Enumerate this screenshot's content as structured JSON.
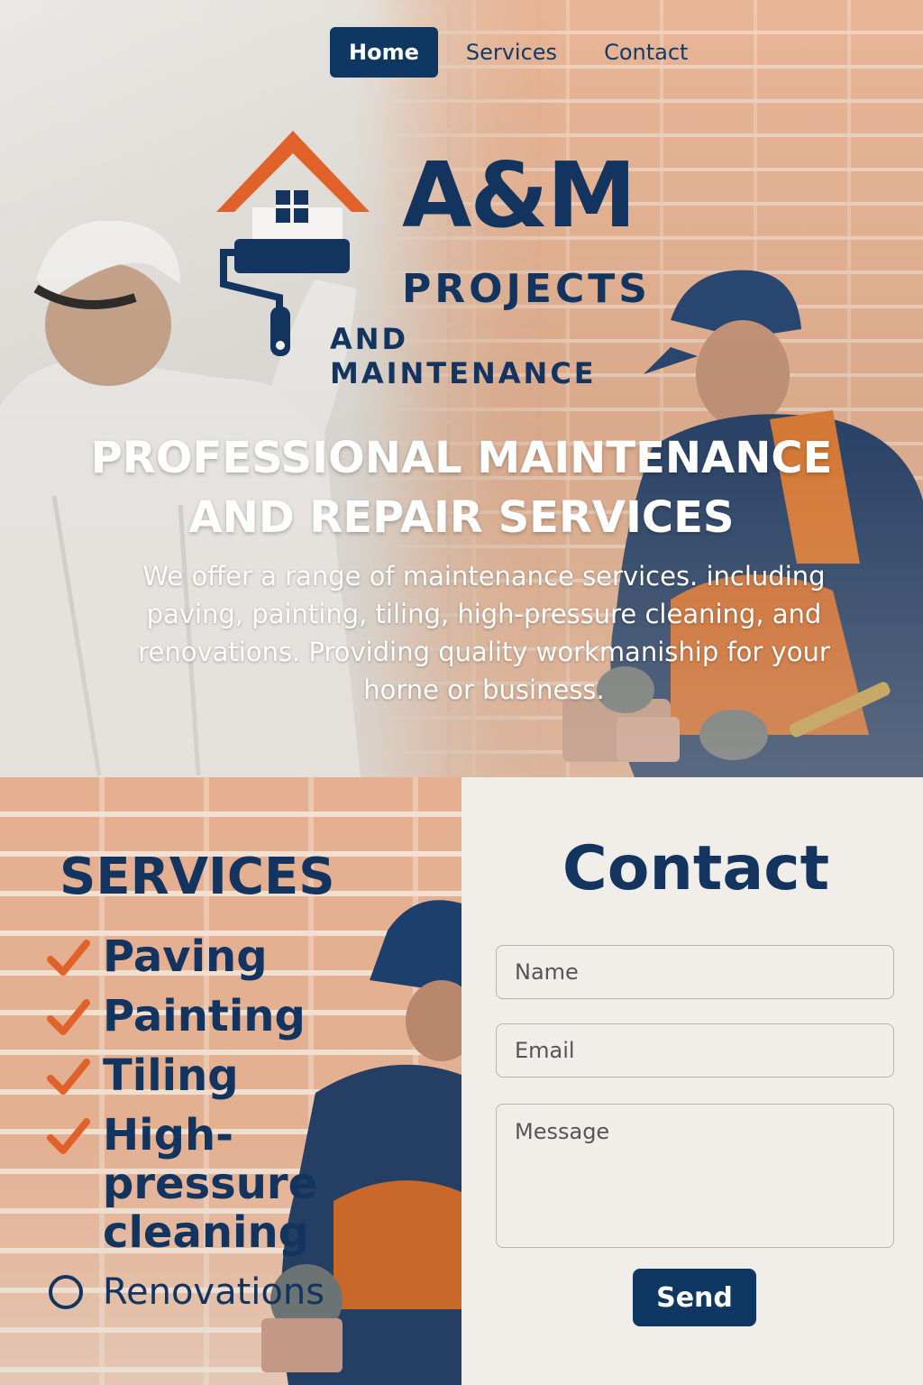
{
  "nav": {
    "items": [
      {
        "label": "Home",
        "active": true
      },
      {
        "label": "Services",
        "active": false
      },
      {
        "label": "Contact",
        "active": false
      }
    ]
  },
  "logo": {
    "main": "A&M",
    "line1": "PROJECTS",
    "line2": "AND MAINTENANCE"
  },
  "hero": {
    "title_line1": "PROFESSIONAL MAINTENANCE",
    "title_line2": "AND REPAIR SERVICES",
    "text": "We offer a range of maintenance services. including paving, painting, tiling, high-pressure cleaning, and renovations. Providing quality workmaniship for your horne or business."
  },
  "services": {
    "title": "SERVICES",
    "items": [
      {
        "label": "Paving",
        "icon": "check-icon"
      },
      {
        "label": "Painting",
        "icon": "check-icon"
      },
      {
        "label": "Tiling",
        "icon": "check-icon"
      },
      {
        "label": "High-pressure cleaning",
        "icon": "check-icon"
      },
      {
        "label": "Renovations",
        "icon": "circle-icon"
      }
    ]
  },
  "contact": {
    "title": "Contact",
    "name_placeholder": "Name",
    "email_placeholder": "Email",
    "message_placeholder": "Message",
    "send_label": "Send"
  },
  "colors": {
    "navy": "#12345f",
    "accent_orange": "#e0622a",
    "panel": "#f1eeea"
  }
}
